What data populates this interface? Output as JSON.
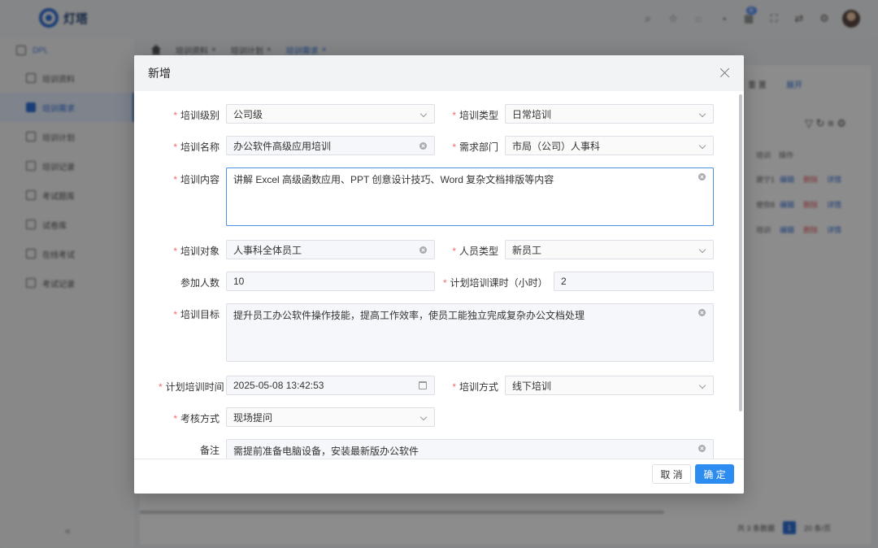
{
  "app": {
    "logo_text": "灯塔",
    "top_badge": "新",
    "sidebar": {
      "header": "DPL",
      "items": [
        "培训资料",
        "培训需求",
        "培训计划",
        "培训记录",
        "考试题库",
        "试卷库",
        "在线考试",
        "考试记录"
      ],
      "active_index": 1
    },
    "tabs": [
      "培训资料",
      "培训计划",
      "培训需求"
    ],
    "content": {
      "top_btns": [
        "重 置",
        "展开"
      ],
      "col_headers": [
        "培训",
        "操作"
      ],
      "rows": [
        {
          "c1": "建宁1",
          "a1": "编辑",
          "a2": "删除",
          "a3": "详情"
        },
        {
          "c1": "使你8",
          "a1": "编辑",
          "a2": "删除",
          "a3": "详情"
        },
        {
          "c1": "培训",
          "a1": "编辑",
          "a2": "删除",
          "a3": "详情"
        }
      ],
      "pager_total": "共 3 条数据",
      "pager_page": "1",
      "pager_size": "20 条/页"
    }
  },
  "dialog": {
    "title": "新增",
    "fields": {
      "level": {
        "label": "培训级别",
        "value": "公司级"
      },
      "type": {
        "label": "培训类型",
        "value": "日常培训"
      },
      "name": {
        "label": "培训名称",
        "value": "办公软件高级应用培训"
      },
      "dept": {
        "label": "需求部门",
        "value": "市局（公司）人事科"
      },
      "content": {
        "label": "培训内容",
        "value": "讲解 Excel 高级函数应用、PPT 创意设计技巧、Word 复杂文档排版等内容"
      },
      "target": {
        "label": "培训对象",
        "value": "人事科全体员工"
      },
      "staff_type": {
        "label": "人员类型",
        "value": "新员工"
      },
      "count": {
        "label": "参加人数",
        "value": "10"
      },
      "hours": {
        "label": "计划培训课时（小时）",
        "value": "2"
      },
      "goal": {
        "label": "培训目标",
        "value": "提升员工办公软件操作技能，提高工作效率，使员工能独立完成复杂办公文档处理"
      },
      "time": {
        "label": "计划培训时间",
        "value": "2025-05-08 13:42:53"
      },
      "method": {
        "label": "培训方式",
        "value": "线下培训"
      },
      "assess": {
        "label": "考核方式",
        "value": "现场提问"
      },
      "remark": {
        "label": "备注",
        "value": "需提前准备电脑设备，安装最新版办公软件"
      }
    },
    "cancel_label": "取 消",
    "ok_label": "确 定"
  },
  "colors": {
    "primary": "#2d8cf0",
    "required": "#f56c6c",
    "focus_border": "#4a90e2"
  }
}
